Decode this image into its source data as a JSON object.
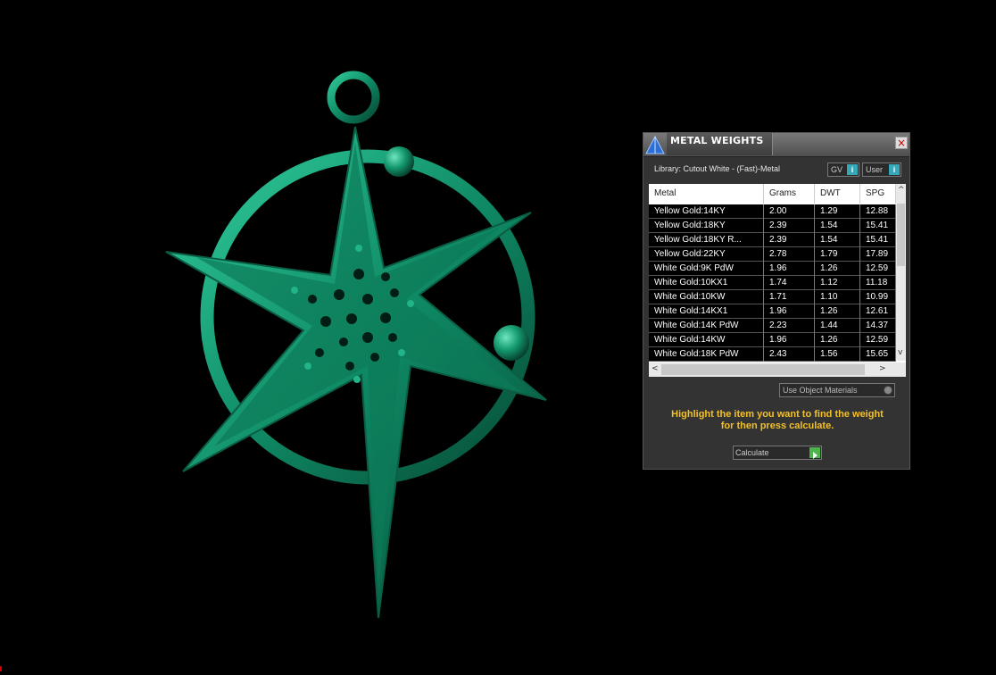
{
  "viewport": {
    "model": "star-pendant-icon",
    "color": "#0f8a65"
  },
  "panel": {
    "title": "METAL WEIGHTS",
    "library": "Library: Cutout White - (Fast)-Metal",
    "toggles": {
      "gv": "GV",
      "user": "User"
    },
    "columns": [
      "Metal",
      "Grams",
      "DWT",
      "SPG"
    ],
    "rows": [
      [
        "Yellow Gold:14KY",
        "2.00",
        "1.29",
        "12.88"
      ],
      [
        "Yellow Gold:18KY",
        "2.39",
        "1.54",
        "15.41"
      ],
      [
        "Yellow Gold:18KY R...",
        "2.39",
        "1.54",
        "15.41"
      ],
      [
        "Yellow Gold:22KY",
        "2.78",
        "1.79",
        "17.89"
      ],
      [
        "White Gold:9K PdW",
        "1.96",
        "1.26",
        "12.59"
      ],
      [
        "White Gold:10KX1",
        "1.74",
        "1.12",
        "11.18"
      ],
      [
        "White Gold:10KW",
        "1.71",
        "1.10",
        "10.99"
      ],
      [
        "White Gold:14KX1",
        "1.96",
        "1.26",
        "12.61"
      ],
      [
        "White Gold:14K PdW",
        "2.23",
        "1.44",
        "14.37"
      ],
      [
        "White Gold:14KW",
        "1.96",
        "1.26",
        "12.59"
      ],
      [
        "White Gold:18K PdW",
        "2.43",
        "1.56",
        "15.65"
      ]
    ],
    "use_object_materials": "Use Object Materials",
    "hint_line1": "Highlight the item you want to find the weight",
    "hint_line2": "for then press calculate.",
    "calculate": "Calculate",
    "accent": "#f2c02a"
  }
}
